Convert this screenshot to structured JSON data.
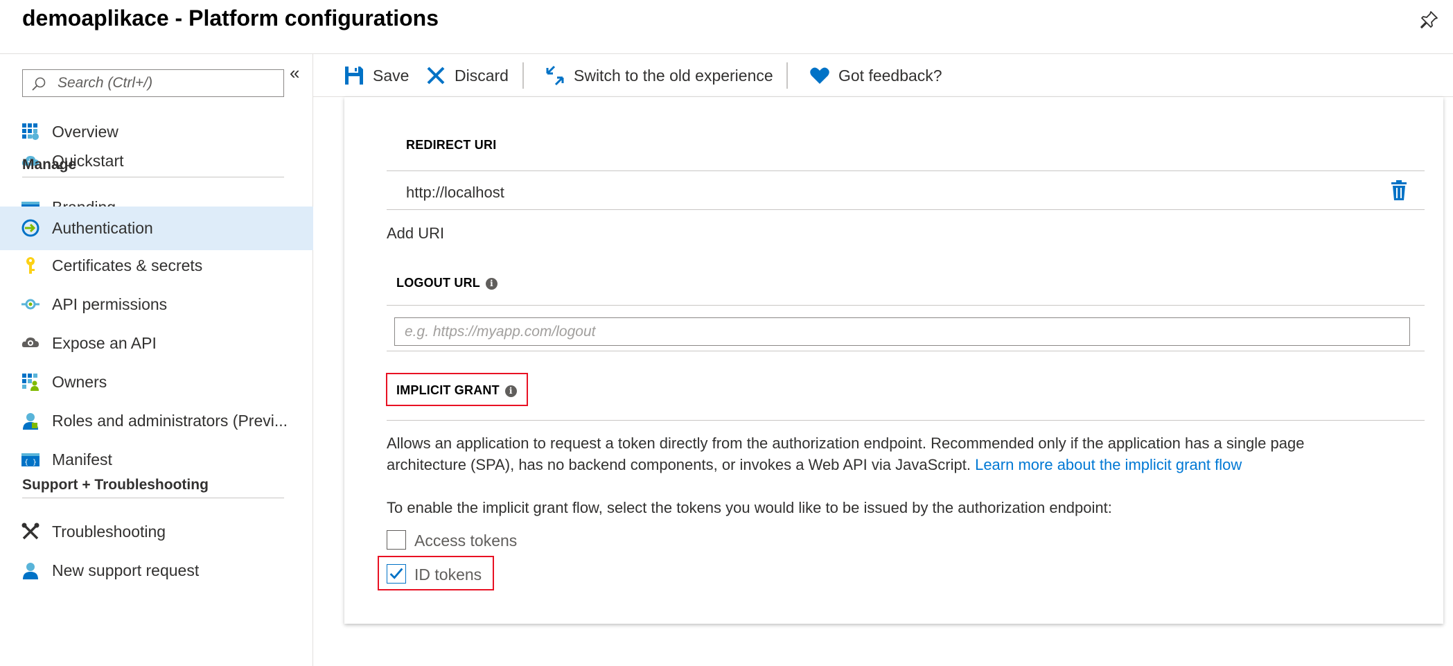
{
  "header": {
    "title": "demoaplikace - Platform configurations"
  },
  "sidebar": {
    "search_placeholder": "Search (Ctrl+/)",
    "collapse_glyph": "«",
    "items_top": [
      {
        "label": "Overview",
        "icon": "grid-icon"
      },
      {
        "label": "Quickstart",
        "icon": "cloud-icon"
      }
    ],
    "manage_heading": "Manage",
    "items_manage": [
      {
        "label": "Branding",
        "icon": "branding-icon"
      },
      {
        "label": "Authentication",
        "icon": "authentication-icon",
        "active": true
      },
      {
        "label": "Certificates & secrets",
        "icon": "key-icon"
      },
      {
        "label": "API permissions",
        "icon": "api-permissions-icon"
      },
      {
        "label": "Expose an API",
        "icon": "cloud-gear-icon"
      },
      {
        "label": "Owners",
        "icon": "owners-icon"
      },
      {
        "label": "Roles and administrators (Previ...",
        "icon": "roles-icon"
      },
      {
        "label": "Manifest",
        "icon": "manifest-icon"
      }
    ],
    "support_heading": "Support + Troubleshooting",
    "items_support": [
      {
        "label": "Troubleshooting",
        "icon": "wrench-icon"
      },
      {
        "label": "New support request",
        "icon": "support-person-icon"
      }
    ]
  },
  "toolbar": {
    "save_label": "Save",
    "discard_label": "Discard",
    "switch_label": "Switch to the old experience",
    "feedback_label": "Got feedback?"
  },
  "card": {
    "redirect_uri_heading": "REDIRECT URI",
    "redirect_uri_value": "http://localhost",
    "add_uri_label": "Add URI",
    "logout_url_heading": "LOGOUT URL",
    "logout_url_placeholder": "e.g. https://myapp.com/logout",
    "implicit_grant_heading": "IMPLICIT GRANT",
    "implicit_desc_line1": "Allows an application to request a token directly from the authorization endpoint. Recommended only if the application has a single page",
    "implicit_desc_line2": "architecture (SPA), has no backend components, or invokes a Web API via JavaScript.",
    "implicit_learn_more": "Learn more about the implicit grant flow",
    "enable_text": "To enable the implicit grant flow, select the tokens you would like to be issued by the authorization endpoint:",
    "access_tokens_label": "Access tokens",
    "access_tokens_checked": false,
    "id_tokens_label": "ID tokens",
    "id_tokens_checked": true
  },
  "colors": {
    "accent": "#0078d4",
    "highlight": "#deecf9",
    "annotation": "#e81123"
  }
}
